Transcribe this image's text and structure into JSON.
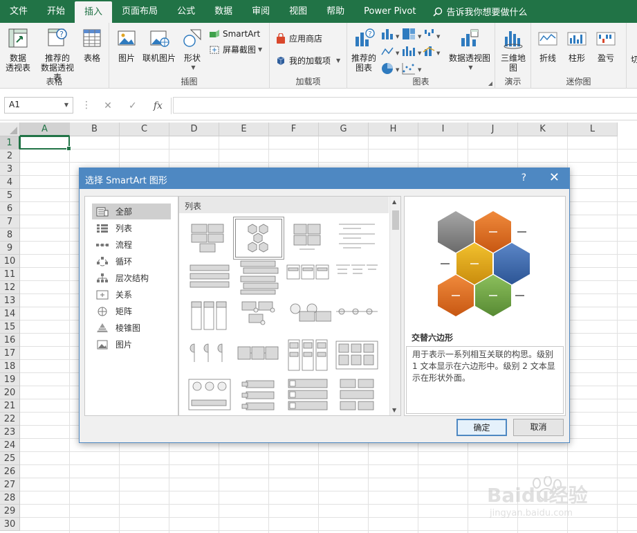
{
  "tabs": [
    "文件",
    "开始",
    "插入",
    "页面布局",
    "公式",
    "数据",
    "审阅",
    "视图",
    "帮助",
    "Power Pivot"
  ],
  "active_tab": "插入",
  "tell_me": "告诉我你想要做什么",
  "ribbon": {
    "table_group": {
      "label": "表格",
      "pivot": "数据\n透视表",
      "recommended_pivot": "推荐的\n数据透视表",
      "table": "表格"
    },
    "illustrations_group": {
      "label": "插图",
      "pictures": "图片",
      "online_pictures": "联机图片",
      "shapes": "形状",
      "smartart": "SmartArt",
      "screenshot": "屏幕截图"
    },
    "addins_group": {
      "label": "加载项",
      "store": "应用商店",
      "my_addins": "我的加载项"
    },
    "charts_group": {
      "label": "图表",
      "recommended": "推荐的\n图表",
      "pivotchart": "数据透视图"
    },
    "tours_group": {
      "label": "演示",
      "map3d": "三维地\n图"
    },
    "sparklines_group": {
      "label": "迷你图",
      "line": "折线",
      "column": "柱形",
      "winloss": "盈亏"
    },
    "cut_off": "切"
  },
  "formula_bar": {
    "namebox": "A1",
    "cancel": "✕",
    "enter": "✓",
    "fx": "fx",
    "value": ""
  },
  "columns": [
    "A",
    "B",
    "C",
    "D",
    "E",
    "F",
    "G",
    "H",
    "I",
    "J",
    "K",
    "L"
  ],
  "rows": [
    "1",
    "2",
    "3",
    "4",
    "5",
    "6",
    "7",
    "8",
    "9",
    "10",
    "11",
    "12",
    "13",
    "14",
    "15",
    "16",
    "17",
    "18",
    "19",
    "20",
    "21",
    "22",
    "23",
    "24",
    "25",
    "26",
    "27",
    "28",
    "29",
    "30"
  ],
  "selected_cell": "A1",
  "dialog": {
    "title": "选择 SmartArt 图形",
    "help": "?",
    "close": "✕",
    "categories": [
      "全部",
      "列表",
      "流程",
      "循环",
      "层次结构",
      "关系",
      "矩阵",
      "棱锥图",
      "图片"
    ],
    "selected_category": "全部",
    "layout_header": "列表",
    "preview_title": "交替六边形",
    "preview_desc": "用于表示一系列相互关联的构思。级别 1 文本显示在六边形中。级别 2 文本显示在形状外面。",
    "ok": "确定",
    "cancel": "取消"
  },
  "watermark": {
    "brand": "Baidu经验",
    "url": "jingyan.baidu.com"
  },
  "colors": {
    "excel_green": "#217346",
    "dialog_blue": "#4e88c2",
    "hex_gray": "#808080",
    "hex_orange": "#e46c1e",
    "hex_yellow": "#e3a619",
    "hex_blue": "#3d6ab3",
    "hex_green": "#6fa245"
  }
}
